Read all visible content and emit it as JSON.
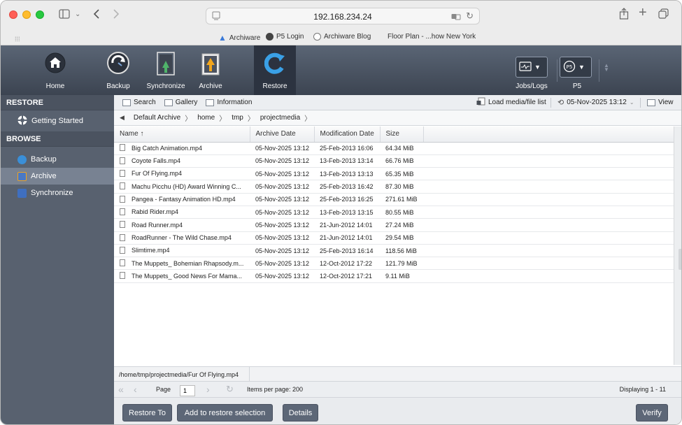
{
  "browser": {
    "address": "192.168.234.24",
    "favorites": [
      "Archiware",
      "P5 Login",
      "Archiware Blog",
      "Floor Plan - ...how New York"
    ]
  },
  "toolbar": {
    "home": "Home",
    "backup": "Backup",
    "synchronize": "Synchronize",
    "archive": "Archive",
    "restore": "Restore",
    "jobs_logs": "Jobs/Logs",
    "p5": "P5"
  },
  "sidebar": {
    "restore_header": "RESTORE",
    "getting_started": "Getting Started",
    "browse_header": "BROWSE",
    "items": [
      "Backup",
      "Archive",
      "Synchronize"
    ]
  },
  "main_toolbar": {
    "search": "Search",
    "gallery": "Gallery",
    "information": "Information",
    "load_list": "Load media/file list",
    "date": "05-Nov-2025 13:12",
    "view": "View"
  },
  "breadcrumb": [
    "Default Archive",
    "home",
    "tmp",
    "projectmedia"
  ],
  "table": {
    "headers": [
      "Name ↑",
      "Archive Date",
      "Modification Date",
      "Size"
    ],
    "rows": [
      [
        "Big Catch Animation.mp4",
        "05-Nov-2025 13:12",
        "25-Feb-2013 16:06",
        "64.34 MiB"
      ],
      [
        "Coyote Falls.mp4",
        "05-Nov-2025 13:12",
        "13-Feb-2013 13:14",
        "66.76 MiB"
      ],
      [
        "Fur Of Flying.mp4",
        "05-Nov-2025 13:12",
        "13-Feb-2013 13:13",
        "65.35 MiB"
      ],
      [
        "Machu Picchu (HD) Award Winning C...",
        "05-Nov-2025 13:12",
        "25-Feb-2013 16:42",
        "87.30 MiB"
      ],
      [
        "Pangea - Fantasy Animation HD.mp4",
        "05-Nov-2025 13:12",
        "25-Feb-2013 16:25",
        "271.61 MiB"
      ],
      [
        "Rabid Rider.mp4",
        "05-Nov-2025 13:12",
        "13-Feb-2013 13:15",
        "80.55 MiB"
      ],
      [
        "Road Runner.mp4",
        "05-Nov-2025 13:12",
        "21-Jun-2012 14:01",
        "27.24 MiB"
      ],
      [
        "RoadRunner - The Wild Chase.mp4",
        "05-Nov-2025 13:12",
        "21-Jun-2012 14:01",
        "29.54 MiB"
      ],
      [
        "Slimtime.mp4",
        "05-Nov-2025 13:12",
        "25-Feb-2013 16:14",
        "118.56 MiB"
      ],
      [
        "The Muppets_ Bohemian Rhapsody.m...",
        "05-Nov-2025 13:12",
        "12-Oct-2012 17:22",
        "121.79 MiB"
      ],
      [
        "The Muppets_ Good News For Mama...",
        "05-Nov-2025 13:12",
        "12-Oct-2012 17:21",
        "9.11 MiB"
      ]
    ]
  },
  "path": "/home/tmp/projectmedia/Fur Of Flying.mp4",
  "pager": {
    "page_label": "Page",
    "page_value": "1",
    "items_per_page": "Items per page: 200",
    "displaying": "Displaying 1 - 11"
  },
  "actions": {
    "restore_to": "Restore To",
    "add_selection": "Add to restore selection",
    "details": "Details",
    "verify": "Verify"
  }
}
